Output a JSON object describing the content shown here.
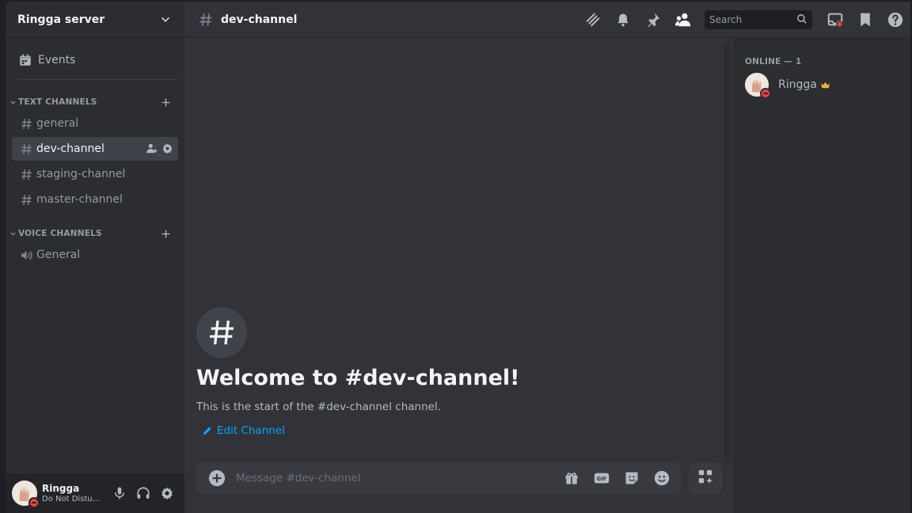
{
  "server": {
    "name": "Ringga server"
  },
  "sidebar": {
    "events_label": "Events",
    "categories": [
      {
        "label": "TEXT CHANNELS"
      },
      {
        "label": "VOICE CHANNELS"
      }
    ],
    "text_channels": [
      {
        "label": "general"
      },
      {
        "label": "dev-channel",
        "active": true
      },
      {
        "label": "staging-channel"
      },
      {
        "label": "master-channel"
      }
    ],
    "voice_channels": [
      {
        "label": "General"
      }
    ]
  },
  "user_panel": {
    "name": "Ringga",
    "status": "Do Not Distu..."
  },
  "topbar": {
    "channel_name": "dev-channel",
    "search_placeholder": "Search",
    "icons": [
      "threads-icon",
      "bell-icon",
      "pin-icon",
      "members-icon",
      "inbox-icon",
      "bookmark-icon",
      "help-icon"
    ]
  },
  "chat": {
    "welcome_title": "Welcome to #dev-channel!",
    "welcome_sub": "This is the start of the #dev-channel channel.",
    "edit_channel_label": "Edit Channel",
    "composer_placeholder": "Message #dev-channel"
  },
  "members": {
    "header": "ONLINE — 1",
    "list": [
      {
        "name": "Ringga"
      }
    ]
  },
  "colors": {
    "accent_link": "#00a8fc",
    "dnd_red": "#f23f43",
    "crown": "#f0b232"
  }
}
